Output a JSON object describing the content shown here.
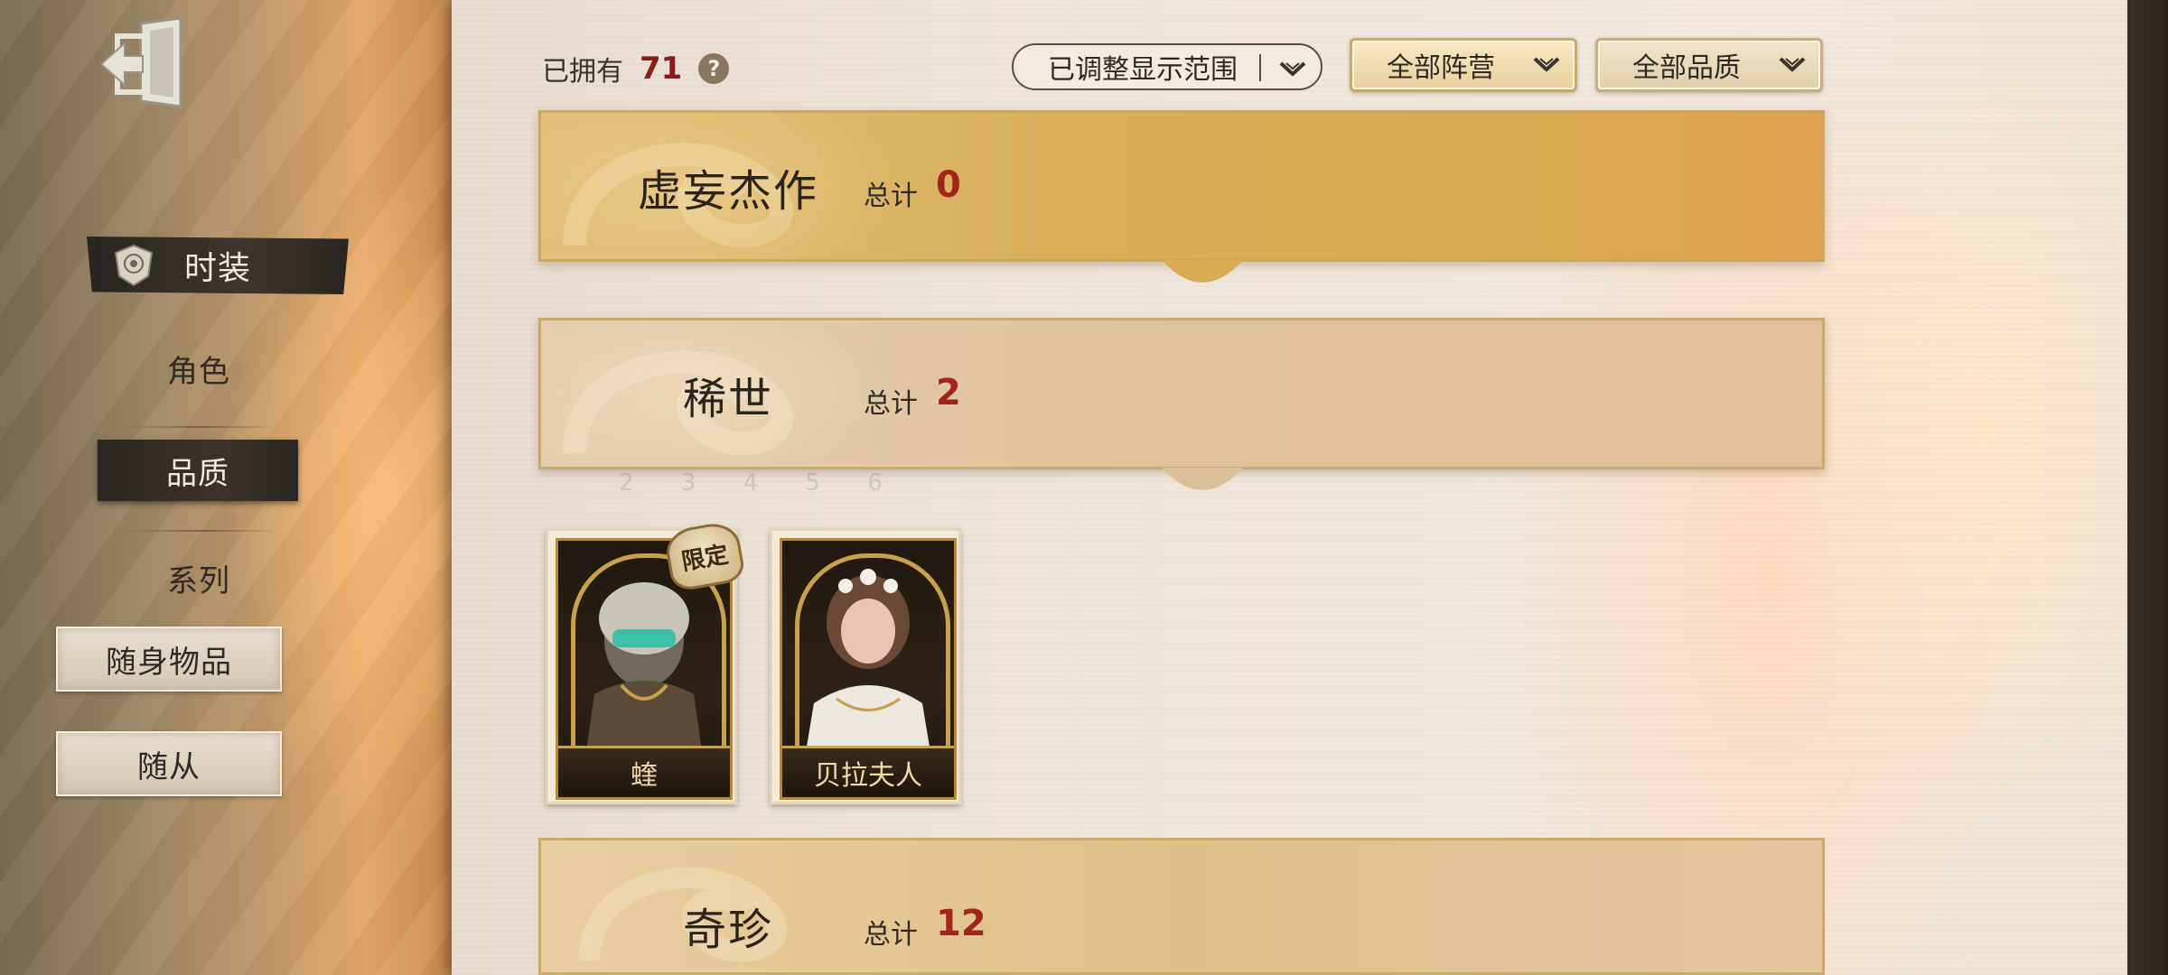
{
  "sidebar": {
    "items": [
      {
        "label": "时装"
      },
      {
        "label": "角色"
      },
      {
        "label": "品质"
      },
      {
        "label": "系列"
      },
      {
        "label": "随身物品"
      },
      {
        "label": "随从"
      }
    ]
  },
  "header": {
    "owned_label": "已拥有",
    "owned_count": "71",
    "help": "?",
    "filters": {
      "range": "已调整显示范围",
      "faction": "全部阵营",
      "quality": "全部品质"
    }
  },
  "sections": [
    {
      "title": "虚妄杰作",
      "total_label": "总计",
      "total": "0"
    },
    {
      "title": "稀世",
      "total_label": "总计",
      "total": "2"
    },
    {
      "title": "奇珍",
      "total_label": "总计",
      "total": "12"
    }
  ],
  "cards": [
    {
      "name": "蝰",
      "tag": "限定"
    },
    {
      "name": "贝拉夫人"
    }
  ],
  "colors": {
    "accent_red": "#a3241f",
    "gold": "#c9a04b"
  }
}
